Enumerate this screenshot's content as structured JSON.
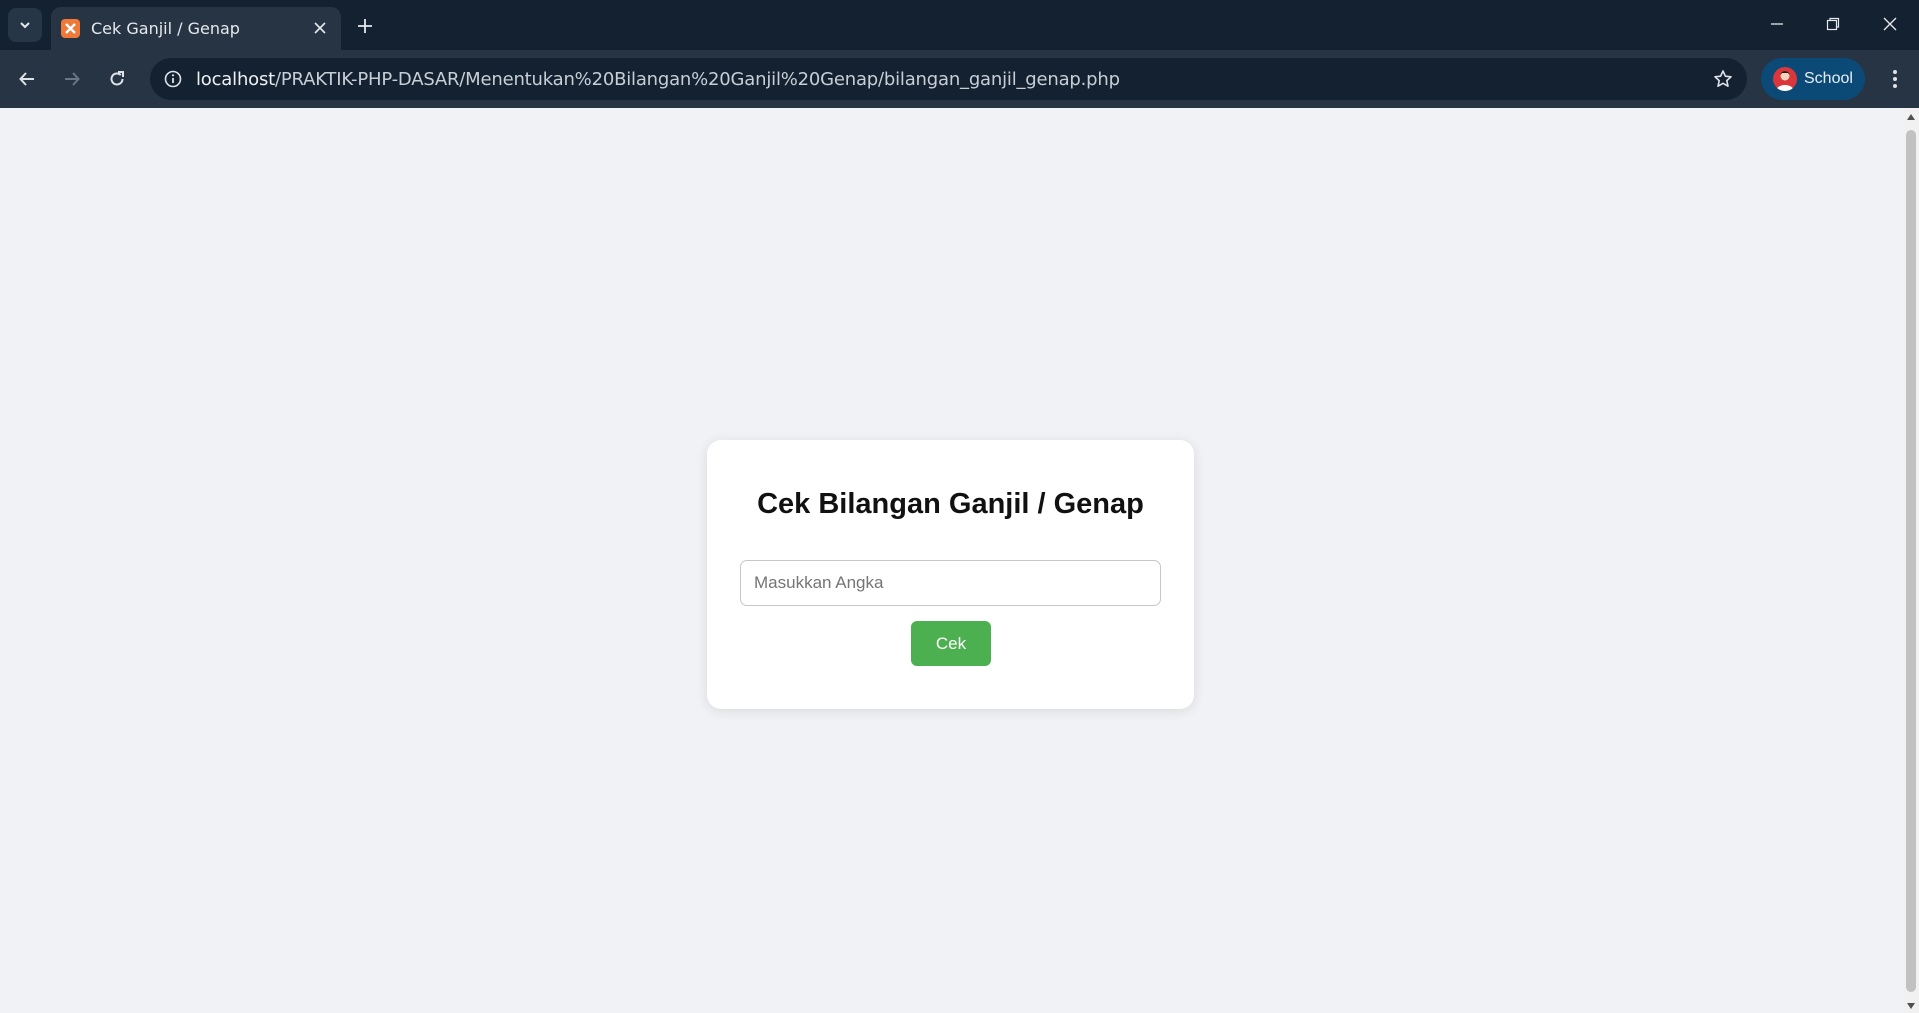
{
  "browser": {
    "tab_title": "Cek Ganjil / Genap",
    "url_host": "localhost",
    "url_path": "/PRAKTIK-PHP-DASAR/Menentukan%20Bilangan%20Ganjil%20Genap/bilangan_ganjil_genap.php",
    "profile_label": "School",
    "icons": [
      "tab-list-icon",
      "favicon-icon",
      "close-icon",
      "plus-icon",
      "minimize-icon",
      "restore-icon",
      "window-close-icon",
      "back-arrow-icon",
      "forward-arrow-icon",
      "reload-icon",
      "info-icon",
      "star-icon",
      "avatar-icon",
      "kebab-menu-icon"
    ],
    "colors": {
      "titlebar": "#132130",
      "toolbar": "#263444",
      "profile_chip": "#0b4a77"
    }
  },
  "page": {
    "title": "Cek Bilangan Ganjil / Genap",
    "input": {
      "value": "",
      "placeholder": "Masukkan Angka"
    },
    "submit_label": "Cek",
    "colors": {
      "background": "#f0f2f5",
      "button": "#4caf50"
    }
  }
}
